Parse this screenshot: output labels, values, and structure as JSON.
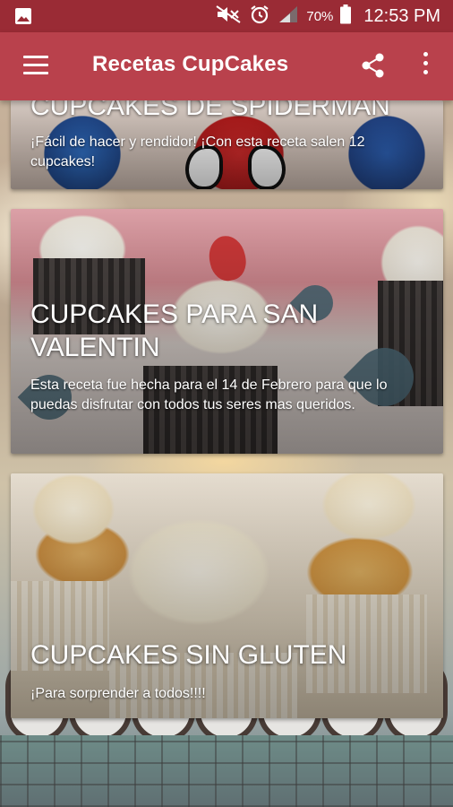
{
  "status_bar": {
    "icons": [
      "image-icon",
      "mute-icon",
      "alarm-icon",
      "signal-icon",
      "battery-icon"
    ],
    "battery": "70%",
    "time": "12:53 PM"
  },
  "app_bar": {
    "title": "Recetas CupCakes",
    "icons": [
      "menu-icon",
      "share-icon",
      "more-vert-icon"
    ],
    "color": "#b9414c"
  },
  "recipes": [
    {
      "title": "CUPCAKES DE SPIDERMAN",
      "description": "¡Fácil de hacer y rendidor! ¡Con esta receta salen 12 cupcakes!"
    },
    {
      "title": "CUPCAKES PARA SAN VALENTIN",
      "description": "Esta receta fue hecha para el 14 de Febrero para que lo puedas disfrutar con todos tus seres mas queridos."
    },
    {
      "title": "CUPCAKES SIN GLUTEN",
      "description": "¡Para sorprender a todos!!!!"
    }
  ]
}
